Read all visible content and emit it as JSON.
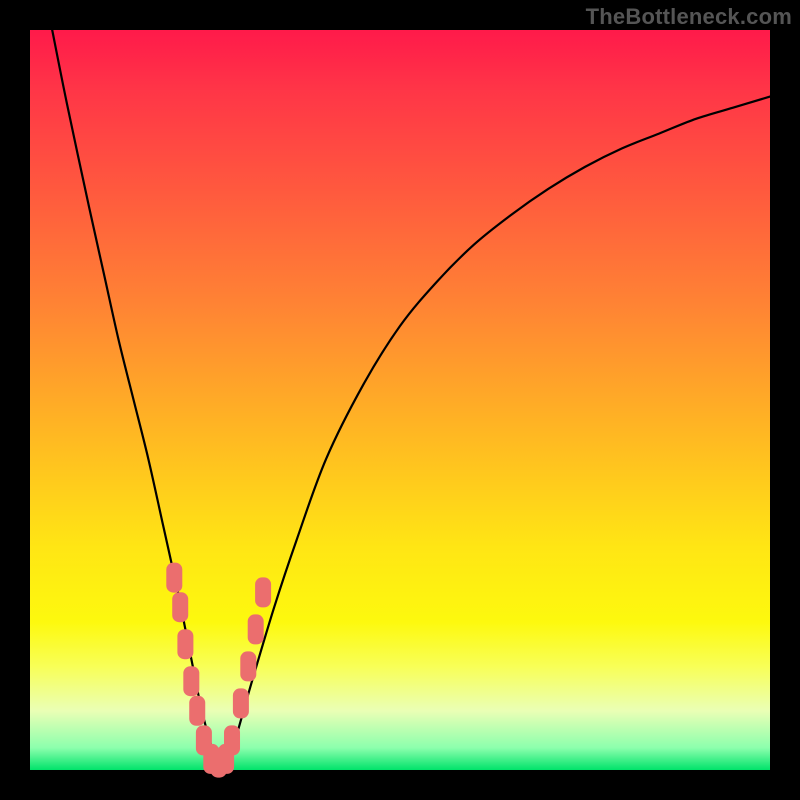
{
  "watermark": "TheBottleneck.com",
  "colors": {
    "frame": "#000000",
    "marker": "#eb6e6e",
    "curve": "#000000",
    "gradient_top": "#ff1a4a",
    "gradient_bottom": "#00e36a"
  },
  "chart_data": {
    "type": "line",
    "title": "",
    "xlabel": "",
    "ylabel": "",
    "xlim": [
      0,
      100
    ],
    "ylim": [
      0,
      100
    ],
    "grid": false,
    "legend": false,
    "series": [
      {
        "name": "bottleneck-curve",
        "x": [
          3,
          5,
          8,
          10,
          12,
          14,
          16,
          18,
          20,
          21,
          22,
          23,
          24,
          25,
          26,
          27,
          28,
          30,
          33,
          36,
          40,
          45,
          50,
          55,
          60,
          65,
          70,
          75,
          80,
          85,
          90,
          95,
          100
        ],
        "y": [
          100,
          90,
          76,
          67,
          58,
          50,
          42,
          33,
          24,
          19,
          14,
          9,
          5,
          2,
          1,
          2,
          5,
          12,
          22,
          31,
          42,
          52,
          60,
          66,
          71,
          75,
          78.5,
          81.5,
          84,
          86,
          88,
          89.5,
          91
        ]
      }
    ],
    "markers": {
      "name": "highlight-segments",
      "shape": "rounded-rect",
      "color": "#eb6e6e",
      "points": [
        {
          "x": 19.5,
          "y": 26
        },
        {
          "x": 20.3,
          "y": 22
        },
        {
          "x": 21.0,
          "y": 17
        },
        {
          "x": 21.8,
          "y": 12
        },
        {
          "x": 22.6,
          "y": 8
        },
        {
          "x": 23.5,
          "y": 4
        },
        {
          "x": 24.5,
          "y": 1.5
        },
        {
          "x": 25.5,
          "y": 1
        },
        {
          "x": 26.5,
          "y": 1.5
        },
        {
          "x": 27.3,
          "y": 4
        },
        {
          "x": 28.5,
          "y": 9
        },
        {
          "x": 29.5,
          "y": 14
        },
        {
          "x": 30.5,
          "y": 19
        },
        {
          "x": 31.5,
          "y": 24
        }
      ]
    }
  }
}
